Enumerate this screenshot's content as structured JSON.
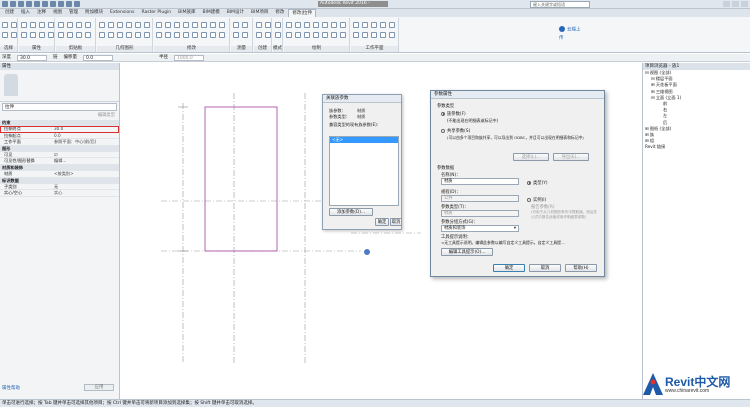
{
  "titlebar": {
    "title": "Autodesk Revit 2016 -",
    "search_placeholder": "键入关键字或短语"
  },
  "tabs": [
    "创建",
    "插入",
    "注释",
    "视图",
    "管理",
    "附加模块",
    "Extensions",
    "Raster Plugin",
    "BIM族库",
    "BIM建模",
    "BIM设计",
    "BIM项目",
    "修改",
    "修改|拉伸"
  ],
  "active_tab": "修改|拉伸",
  "ribbon": {
    "groups": [
      "选择",
      "属性",
      "剪贴板",
      "几何图形",
      "修改",
      "测量",
      "创建",
      "模式",
      "绘制",
      "工作平面"
    ],
    "cloud_label": "云端上传"
  },
  "optbar": {
    "depth_label": "深度",
    "depth_value": "30.0",
    "chain_label": "链",
    "offset_label": "偏移量",
    "offset_value": "0.0",
    "radius_label": "半径",
    "radius_value": "1000.0"
  },
  "props": {
    "header": "属性",
    "type": "拉伸",
    "edit_type": "编辑类型",
    "rows": [
      {
        "cat": true,
        "k": "约束"
      },
      {
        "k": "拉伸终点",
        "v": "30.0",
        "hl": true
      },
      {
        "k": "拉伸起点",
        "v": "0.0"
      },
      {
        "k": "工作平面",
        "v": "参照平面：中心(前/后)"
      },
      {
        "cat": true,
        "k": "图形"
      },
      {
        "k": "可见",
        "v": "☑"
      },
      {
        "k": "可见性/图形替换",
        "v": "编辑..."
      },
      {
        "cat": true,
        "k": "材质和装饰"
      },
      {
        "k": "材质",
        "v": "<按类别>"
      },
      {
        "cat": true,
        "k": "标识数据"
      },
      {
        "k": "子类别",
        "v": "无"
      },
      {
        "k": "实心/空心",
        "v": "实心"
      }
    ],
    "help": "属性帮助",
    "apply": "应用"
  },
  "browser": {
    "header": "项目浏览器 - 族1",
    "items": [
      {
        "indent": 0,
        "text": "⊟ 视图 (全部)"
      },
      {
        "indent": 1,
        "text": "⊟ 楼层平面"
      },
      {
        "indent": 1,
        "text": "⊞ 天花板平面"
      },
      {
        "indent": 1,
        "text": "⊞ 三维视图"
      },
      {
        "indent": 1,
        "text": "⊟ 立面 (立面 1)"
      },
      {
        "indent": 3,
        "text": "前"
      },
      {
        "indent": 3,
        "text": "右"
      },
      {
        "indent": 3,
        "text": "左"
      },
      {
        "indent": 3,
        "text": "后"
      },
      {
        "indent": 0,
        "text": "⊞ 图纸 (全部)"
      },
      {
        "indent": 0,
        "text": "⊞ 族"
      },
      {
        "indent": 0,
        "text": "⊞ 组"
      },
      {
        "indent": 0,
        "text": "  Revit 链接"
      }
    ]
  },
  "status": "单击可进行选择；按 Tab 键并单击可选择其他项目；按 Ctrl 键并单击可将新项目添加到选择集；按 Shift 键并单击可取消选择。",
  "dlg1": {
    "title": "关联族参数",
    "rows": [
      {
        "k": "族参数：",
        "v": "材质"
      },
      {
        "k": "参数类型：",
        "v": "材质"
      }
    ],
    "list_label": "兼容类型的现有族参数(E)：",
    "selected": "<无>",
    "add_btn": "添加参数(D)...",
    "ok": "确定",
    "cancel": "取消"
  },
  "dlg2": {
    "title": "参数属性",
    "type_label": "参数类型",
    "family_param": "族参数(F)",
    "family_desc": "(不能出现在明细表或标记中)",
    "shared_param": "共享参数(S)",
    "shared_desc": "(可以由多个项目和族共享，可以导出到 ODBC，并且可以出现在明细表和标记中)",
    "select_btn": "选择(L)...",
    "export_btn": "导出(E)...",
    "data_label": "参数数据",
    "name_label": "名称(N)：",
    "name_value": "材质",
    "discipline_label": "规程(D)：",
    "discipline_value": "公共",
    "ptype_label": "参数类型(T)：",
    "ptype_value": "材质",
    "group_label": "参数分组方式(G)：",
    "group_value": "材质和装饰",
    "type_opt": "类型(Y)",
    "inst_opt": "实例(I)",
    "report_opt": "报告参数(R)",
    "report_desc": "(可用于从几何图形条件中提取值，然后在公式中报告此值或用作明细表参数)",
    "tooltip_label": "工具提示说明：",
    "tooltip_value": "<无工具提示说明。编辑此参数以编写自定义工具提示。自定义工具提...",
    "edit_tooltip_btn": "编辑工具提示(O)...",
    "ok": "确定",
    "cancel": "取消",
    "help": "帮助(H)"
  },
  "watermark": {
    "title": "Revit中文网",
    "url": "www.chinarevit.com"
  }
}
